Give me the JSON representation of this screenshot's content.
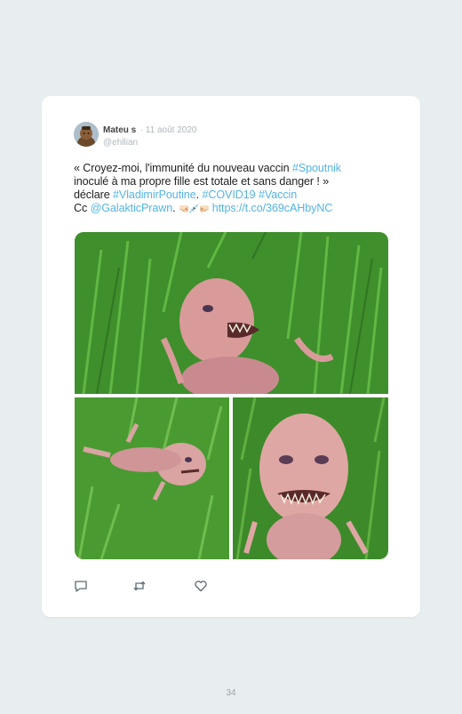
{
  "tweet": {
    "author_name": "Mateu s",
    "date": "11 août 2020",
    "handle": "@ehllian",
    "text": {
      "l1_a": "« Croyez-moi, l'immunité du nouveau vaccin ",
      "l1_tag": "#Spoutnik",
      "l2": "inoculé à ma propre fille est totale et sans danger ! »",
      "l3_a": "déclare ",
      "l3_tag1": "#VladimirPoutine",
      "l3_sep": ". ",
      "l3_tag2": "#COVID19",
      "l3_space": " ",
      "l3_tag3": "#Vaccin",
      "l4_a": "Cc ",
      "l4_mention": "@GalakticPrawn",
      "l4_dot": ". ",
      "l4_emoji": "🤜🏻💉🤛🏻",
      "l4_space": " ",
      "l4_link": "https://t.co/369cAHbyNC"
    },
    "colors": {
      "link": "#54b4e3",
      "text": "#222222",
      "meta": "#b0b7bc"
    },
    "media": {
      "photos": [
        "creature-in-grass-top",
        "creature-lying-grass",
        "creature-closeup"
      ]
    },
    "actions": [
      "reply-icon",
      "retweet-icon",
      "like-icon"
    ]
  },
  "page": {
    "number": "34"
  }
}
